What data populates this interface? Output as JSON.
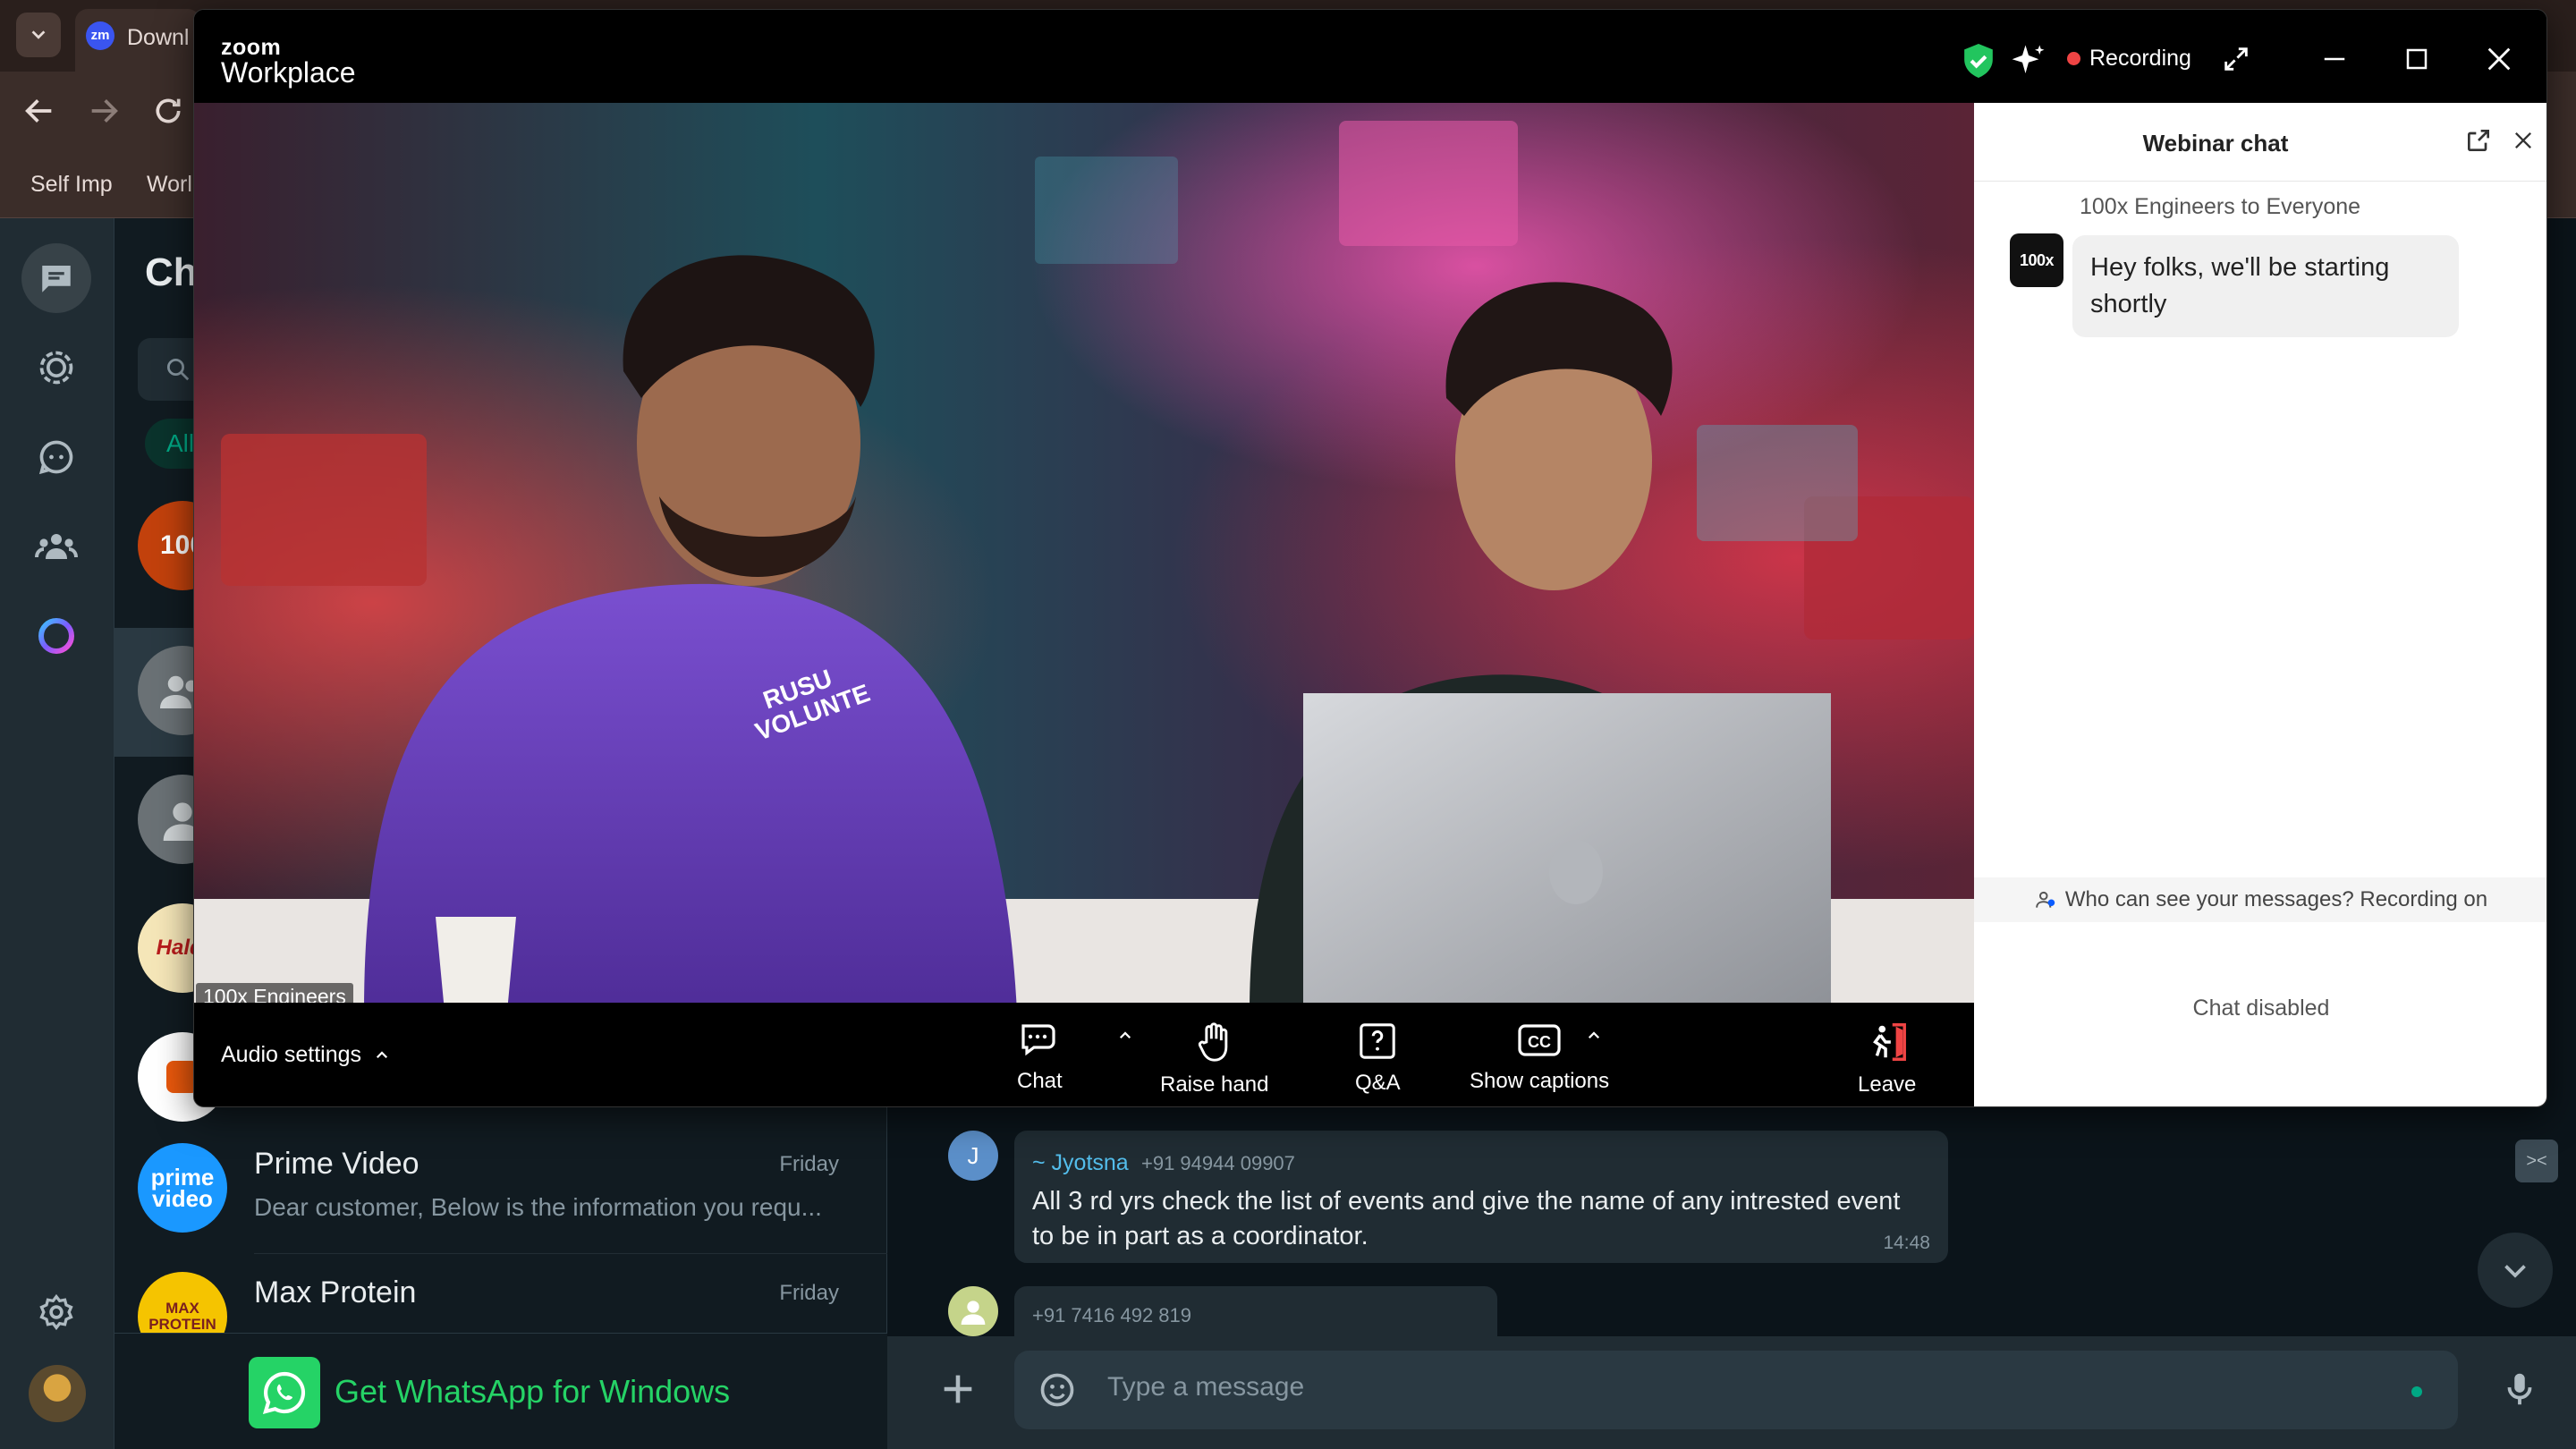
{
  "browser": {
    "tab_title": "Downl",
    "tab_icon_text": "zm",
    "bookmarks": [
      "Self Imp",
      "Worl"
    ]
  },
  "whatsapp": {
    "list_header": "Ch",
    "filter_chip": "All",
    "chats": [
      {
        "name": "Prime Video",
        "time": "Friday",
        "preview": "Dear customer, Below is the information you requ...",
        "avatar": "prime video"
      },
      {
        "name": "Max Protein",
        "time": "Friday",
        "preview": "",
        "avatar": "MAX PROTEIN"
      }
    ],
    "partial_avatars": [
      "100",
      "Haldi"
    ],
    "get_app": "Get WhatsApp for Windows",
    "messages": [
      {
        "sender": "~ Jyotsna",
        "phone": "+91 94944 09907",
        "avatar_letter": "J",
        "text": "All 3 rd yrs check the list of events and give the name of any intrested event to be in part as a coordinator.",
        "time": "14:48"
      },
      {
        "phone": "+91 7416 492 819"
      }
    ],
    "composer_placeholder": "Type a message"
  },
  "zoom": {
    "brand_top": "zoom",
    "brand_bottom": "Workplace",
    "recording_label": "Recording",
    "colors": {
      "shield": "#22c55e",
      "recording_dot": "#ef4444",
      "accent": "#0b5cff"
    },
    "video_label": "100x Engineers",
    "hoodie_text": "RUSU VOLUNTE",
    "audio_settings": "Audio settings",
    "controls": [
      {
        "label": "Chat",
        "icon": "chat-icon"
      },
      {
        "label": "Raise hand",
        "icon": "raise-hand-icon"
      },
      {
        "label": "Q&A",
        "icon": "qa-icon"
      },
      {
        "label": "Show captions",
        "icon": "captions-icon"
      },
      {
        "label": "Leave",
        "icon": "leave-icon"
      }
    ],
    "chat_panel": {
      "title": "Webinar chat",
      "sender_line": "100x Engineers to Everyone",
      "avatar_text": "100x",
      "message": "Hey folks, we'll be starting shortly",
      "visibility_notice": "Who can see your messages? Recording on",
      "disabled_text": "Chat disabled"
    }
  }
}
